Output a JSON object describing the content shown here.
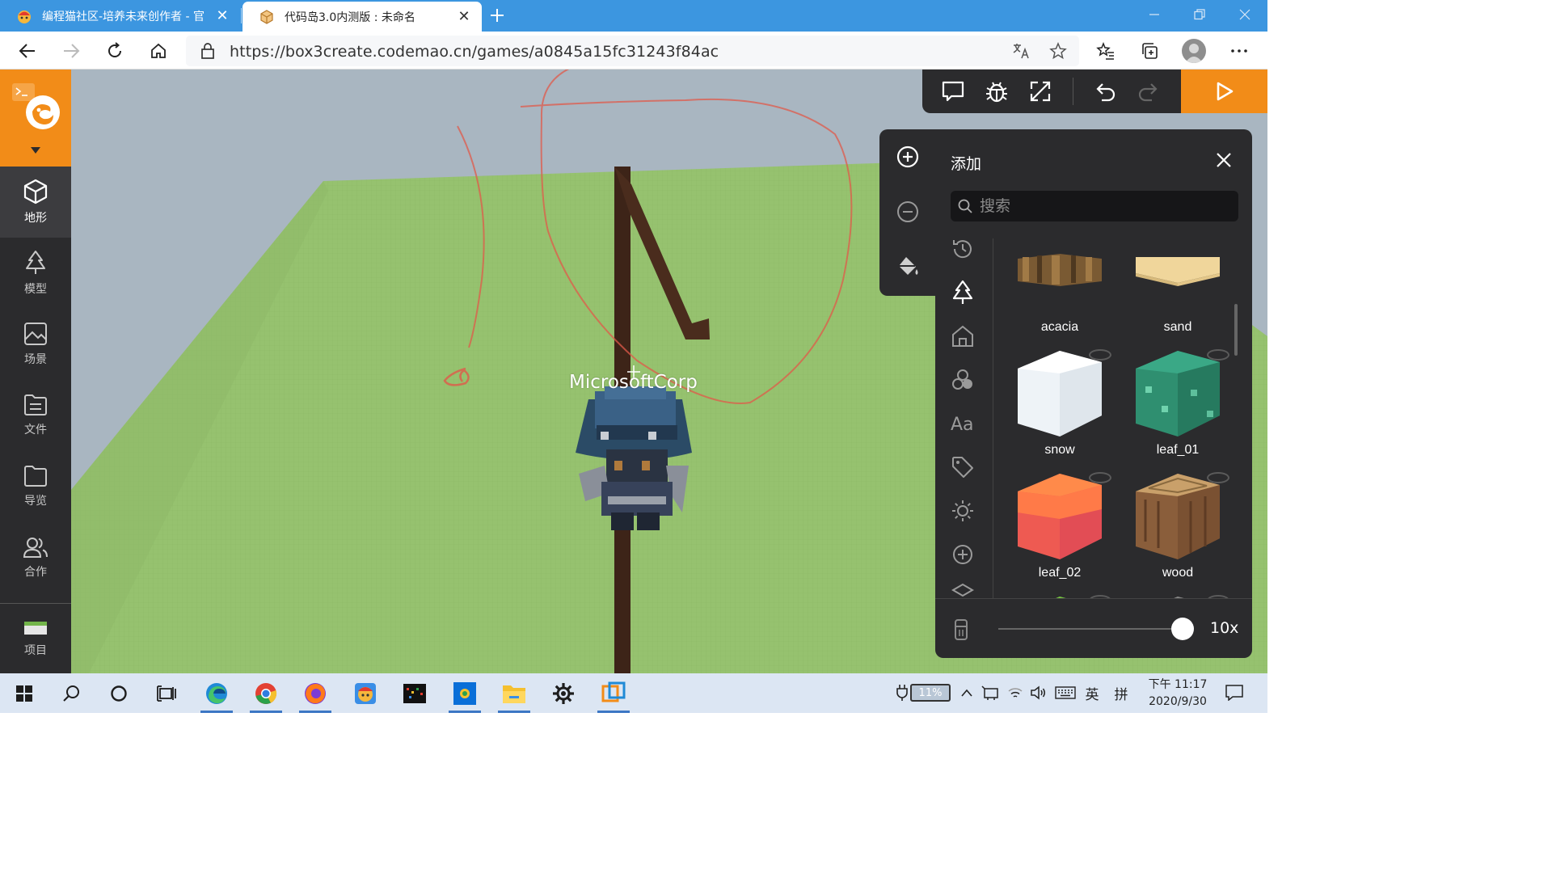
{
  "browser": {
    "tabs": [
      {
        "title": "编程猫社区-培养未来创作者 - 官",
        "active": false
      },
      {
        "title": "代码岛3.0内测版 : 未命名",
        "active": true
      }
    ],
    "url": "https://box3create.codemao.cn/games/a0845a15fc31243f84ac"
  },
  "sidebar": {
    "items": [
      {
        "label": "地形",
        "icon": "cube-icon",
        "active": true
      },
      {
        "label": "模型",
        "icon": "tree-icon",
        "active": false
      },
      {
        "label": "场景",
        "icon": "image-icon",
        "active": false
      },
      {
        "label": "文件",
        "icon": "file-icon",
        "active": false
      },
      {
        "label": "导览",
        "icon": "folder-icon",
        "active": false
      },
      {
        "label": "合作",
        "icon": "users-icon",
        "active": false
      }
    ],
    "project_label": "项目"
  },
  "scene": {
    "player_name": "MicrosoftCorp"
  },
  "add_panel": {
    "title": "添加",
    "search_placeholder": "搜索",
    "blocks": [
      {
        "name": "acacia"
      },
      {
        "name": "sand"
      },
      {
        "name": "snow"
      },
      {
        "name": "leaf_01"
      },
      {
        "name": "leaf_02"
      },
      {
        "name": "wood"
      },
      {
        "name": ""
      },
      {
        "name": ""
      }
    ],
    "brush_size_fraction": 1.0,
    "brush_size_label": "10x"
  },
  "taskbar": {
    "battery": "11%",
    "ime_lang": "英",
    "ime_mode": "拼",
    "time": "下午 11:17",
    "date": "2020/9/30"
  },
  "colors": {
    "accent": "#f28c18",
    "panel": "#2b2b2d",
    "ground": "#96c26f",
    "sky": "#a9b6c1"
  }
}
